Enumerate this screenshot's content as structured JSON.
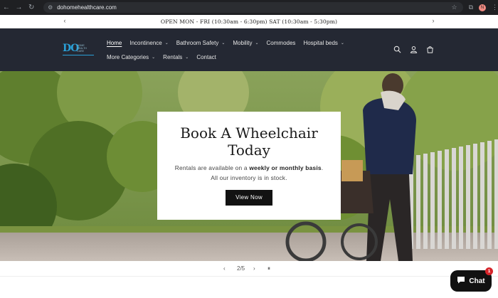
{
  "browser": {
    "url": "dohomehealthcare.com",
    "profile_initial": "N",
    "icons": [
      "back-icon",
      "forward-icon",
      "reload-icon",
      "site-info-icon",
      "bookmark-star-icon",
      "extensions-icon",
      "menu-icon"
    ]
  },
  "announcement": {
    "text": "OPEN MON - FRI (10:30am - 6:30pm) SAT (10:30am - 5:30pm)",
    "prev_icon": "‹",
    "next_icon": "›"
  },
  "logo": {
    "mark": "DO",
    "tagline": "HOME HEALTH CARE"
  },
  "nav": {
    "row1": [
      {
        "label": "Home",
        "has_dropdown": false,
        "active": true
      },
      {
        "label": "Incontinence",
        "has_dropdown": true
      },
      {
        "label": "Bathroom Safety",
        "has_dropdown": true
      },
      {
        "label": "Mobility",
        "has_dropdown": true
      },
      {
        "label": "Commodes",
        "has_dropdown": false
      },
      {
        "label": "Hospital beds",
        "has_dropdown": true
      }
    ],
    "row2": [
      {
        "label": "More Categories",
        "has_dropdown": true
      },
      {
        "label": "Rentals",
        "has_dropdown": true
      },
      {
        "label": "Contact",
        "has_dropdown": false
      }
    ],
    "chevron": "⌄"
  },
  "header_icons": [
    "search-icon",
    "account-icon",
    "cart-icon"
  ],
  "hero": {
    "heading": "Book A Wheelchair Today",
    "body_before": "Rentals are available on a ",
    "body_bold": "weekly or monthly basis",
    "body_after": ". All our inventory is in stock.",
    "button": "View Now"
  },
  "slideshow": {
    "counter": "2/5",
    "prev": "‹",
    "next": "›",
    "pause": "⏸"
  },
  "chat": {
    "label": "Chat",
    "badge": "1"
  },
  "colors": {
    "header_bg": "#242833",
    "browser_bg": "#1f2023",
    "logo_blue": "#2a9fd6",
    "button_bg": "#121212",
    "badge_red": "#d6242a"
  }
}
